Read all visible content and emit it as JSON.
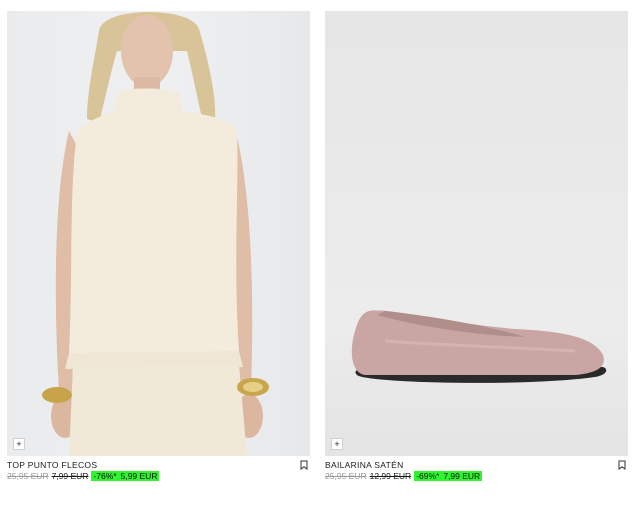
{
  "products": [
    {
      "name": "TOP PUNTO FLECOS",
      "original_price": "25,95 EUR",
      "previous_price": "7,99 EUR",
      "discount": "-76%*",
      "price": "5,99 EUR",
      "image_icon": "model-wearing-knit-top-image",
      "add_icon": "plus-icon",
      "bookmark_icon": "bookmark-icon"
    },
    {
      "name": "BAILARINA SATÉN",
      "original_price": "25,95 EUR",
      "previous_price": "12,99 EUR",
      "discount": "-69%*",
      "price": "7,99 EUR",
      "image_icon": "satin-ballet-flat-image",
      "add_icon": "plus-icon",
      "bookmark_icon": "bookmark-icon"
    }
  ],
  "colors": {
    "discount_highlight": "#2ef52e",
    "shoe": "#c9a6a3"
  },
  "add_symbol": "+"
}
